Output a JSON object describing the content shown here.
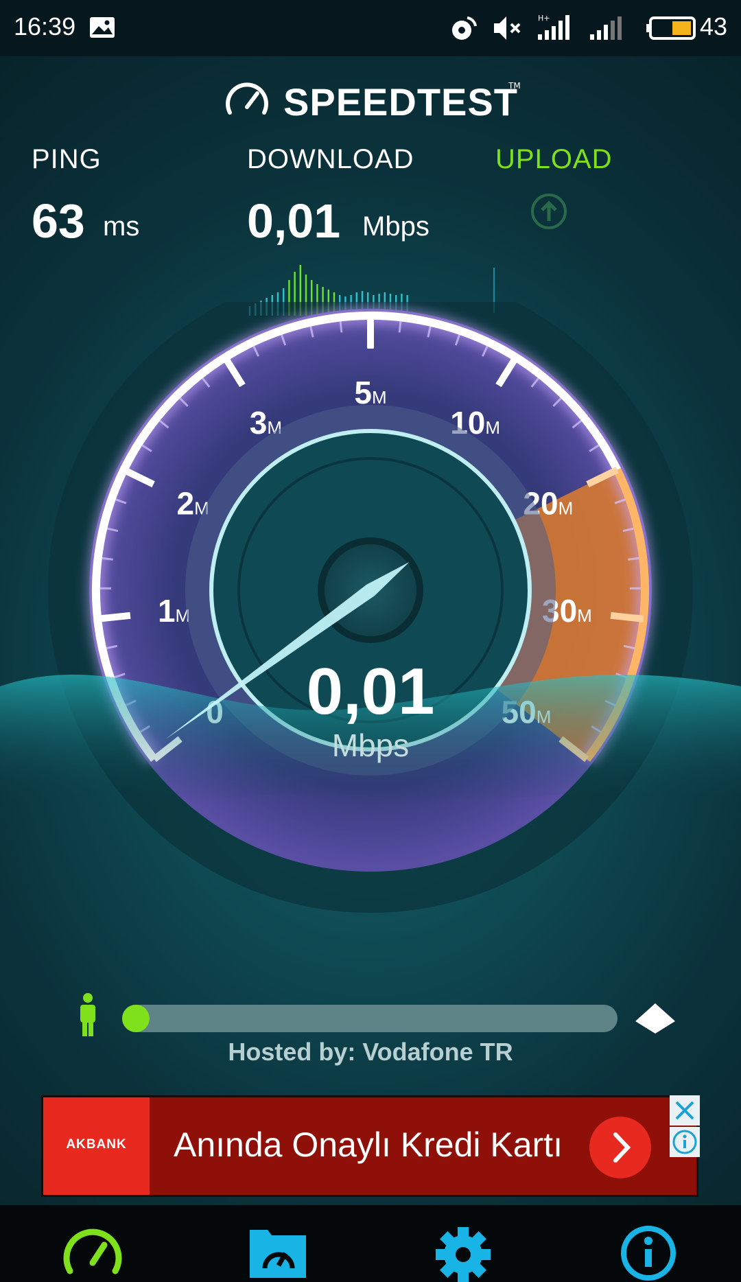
{
  "status_bar": {
    "time": "16:39",
    "battery_level": "43",
    "icons": [
      "image-icon",
      "cast-icon",
      "mute-icon",
      "signal-hplus-icon",
      "signal-icon",
      "battery-icon"
    ]
  },
  "app": {
    "title": "SPEEDTEST",
    "trademark": "TM",
    "accent_color": "#7fe01c",
    "upload_color": "#7fe01c"
  },
  "metrics": {
    "ping": {
      "label": "PING",
      "value": "63",
      "unit": "ms"
    },
    "download": {
      "label": "DOWNLOAD",
      "value": "0,01",
      "unit": "Mbps"
    },
    "upload": {
      "label": "UPLOAD"
    }
  },
  "gauge": {
    "reading": "0,01",
    "unit": "Mbps",
    "tick_labels": [
      {
        "num": "0",
        "suffix": ""
      },
      {
        "num": "1",
        "suffix": "M"
      },
      {
        "num": "2",
        "suffix": "M"
      },
      {
        "num": "3",
        "suffix": "M"
      },
      {
        "num": "5",
        "suffix": "M"
      },
      {
        "num": "10",
        "suffix": "M"
      },
      {
        "num": "20",
        "suffix": "M"
      },
      {
        "num": "30",
        "suffix": "M"
      },
      {
        "num": "50",
        "suffix": "M"
      }
    ],
    "needle_value_mbps": 0.01
  },
  "server": {
    "hosted_by": "Hosted by: Vodafone TR",
    "progress": 0.03
  },
  "ad": {
    "brand": "AKBANK",
    "text": "Anında Onaylı Kredi Kartı",
    "brand_color": "#e8291f"
  },
  "bottom_nav": [
    {
      "name": "speedtest-tab-icon",
      "color": "#7fe01c"
    },
    {
      "name": "results-tab-icon",
      "color": "#18b4e6"
    },
    {
      "name": "settings-tab-icon",
      "color": "#18b4e6"
    },
    {
      "name": "info-tab-icon",
      "color": "#18b4e6"
    }
  ]
}
